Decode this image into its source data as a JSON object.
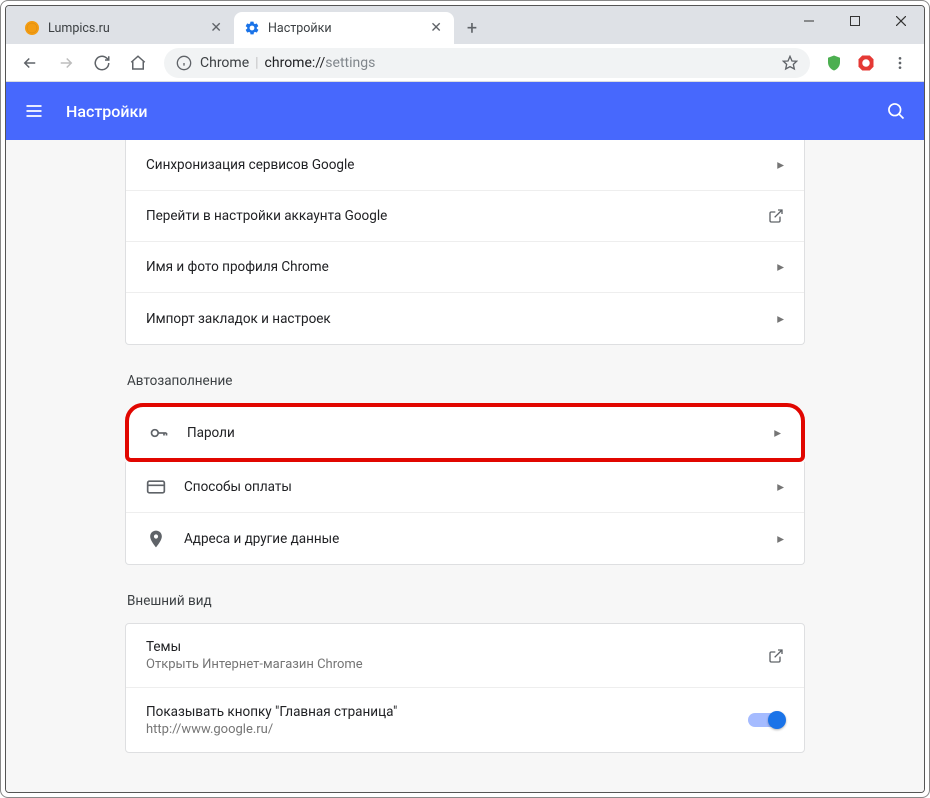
{
  "tabs": [
    {
      "title": "Lumpics.ru",
      "favicon_color": "#f39c12"
    },
    {
      "title": "Настройки",
      "favicon_color": "#1a73e8"
    }
  ],
  "omnibox": {
    "prefix": "Chrome",
    "scheme": "chrome://",
    "path": "settings"
  },
  "appbar": {
    "title": "Настройки"
  },
  "sync_card": {
    "items": [
      {
        "label": "Синхронизация сервисов Google",
        "type": "arrow"
      },
      {
        "label": "Перейти в настройки аккаунта Google",
        "type": "external"
      },
      {
        "label": "Имя и фото профиля Chrome",
        "type": "arrow"
      },
      {
        "label": "Импорт закладок и настроек",
        "type": "arrow"
      }
    ]
  },
  "section_autofill": {
    "title": "Автозаполнение",
    "items": [
      {
        "label": "Пароли",
        "icon": "key"
      },
      {
        "label": "Способы оплаты",
        "icon": "card"
      },
      {
        "label": "Адреса и другие данные",
        "icon": "pin"
      }
    ]
  },
  "section_appearance": {
    "title": "Внешний вид",
    "themes": {
      "line1": "Темы",
      "line2": "Открыть Интернет-магазин Chrome"
    },
    "home": {
      "line1": "Показывать кнопку \"Главная страница\"",
      "line2": "http://www.google.ru/"
    }
  }
}
